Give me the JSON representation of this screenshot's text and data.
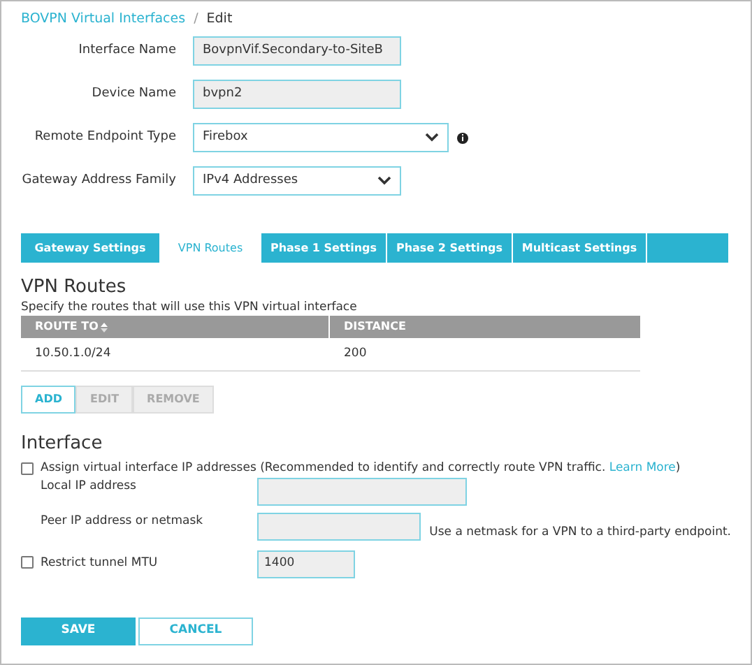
{
  "breadcrumb": {
    "link": "BOVPN Virtual Interfaces",
    "separator": "/",
    "current": "Edit"
  },
  "fields": [
    {
      "label": "Interface Name",
      "kind": "text",
      "value": "BovpnVif.Secondary-to-SiteB",
      "disabled": true
    },
    {
      "label": "Device Name",
      "kind": "text",
      "value": "bvpn2",
      "disabled": true
    },
    {
      "label": "Remote Endpoint Type",
      "kind": "select",
      "value": "Firebox",
      "disabled": false,
      "info": true
    },
    {
      "label": "Gateway Address Family",
      "kind": "select",
      "value": "IPv4 Addresses",
      "disabled": false,
      "info": false
    }
  ],
  "tabs": [
    {
      "label": "Gateway Settings",
      "selected": false
    },
    {
      "label": "VPN Routes",
      "selected": true
    },
    {
      "label": "Phase 1 Settings",
      "selected": false
    },
    {
      "label": "Phase 2 Settings",
      "selected": false
    },
    {
      "label": "Multicast Settings",
      "selected": false
    }
  ],
  "routes": {
    "title": "VPN Routes",
    "description": "Specify the routes that will use this VPN virtual interface",
    "columns": [
      {
        "label": "ROUTE TO",
        "sortable": true
      },
      {
        "label": "DISTANCE",
        "sortable": false
      }
    ],
    "rows": [
      [
        "10.50.1.0/24",
        "200"
      ]
    ],
    "buttons": [
      {
        "label": "ADD",
        "disabled": false
      },
      {
        "label": "EDIT",
        "disabled": true
      },
      {
        "label": "REMOVE",
        "disabled": true
      }
    ]
  },
  "interface": {
    "title": "Interface",
    "assign": {
      "checked": false,
      "text": "Assign virtual interface IP addresses (Recommended to identify and correctly route VPN traffic. ",
      "link": "Learn More",
      "text_after": ")"
    },
    "local_ip": {
      "label": "Local IP address"
    },
    "peer_ip": {
      "label": "Peer IP address or netmask",
      "note": "Use a netmask for a VPN to a third-party endpoint."
    },
    "mtu": {
      "checked": false,
      "label": "Restrict tunnel MTU",
      "value": "1400"
    }
  },
  "actions": [
    {
      "label": "SAVE",
      "primary": true
    },
    {
      "label": "CANCEL",
      "primary": false
    }
  ]
}
